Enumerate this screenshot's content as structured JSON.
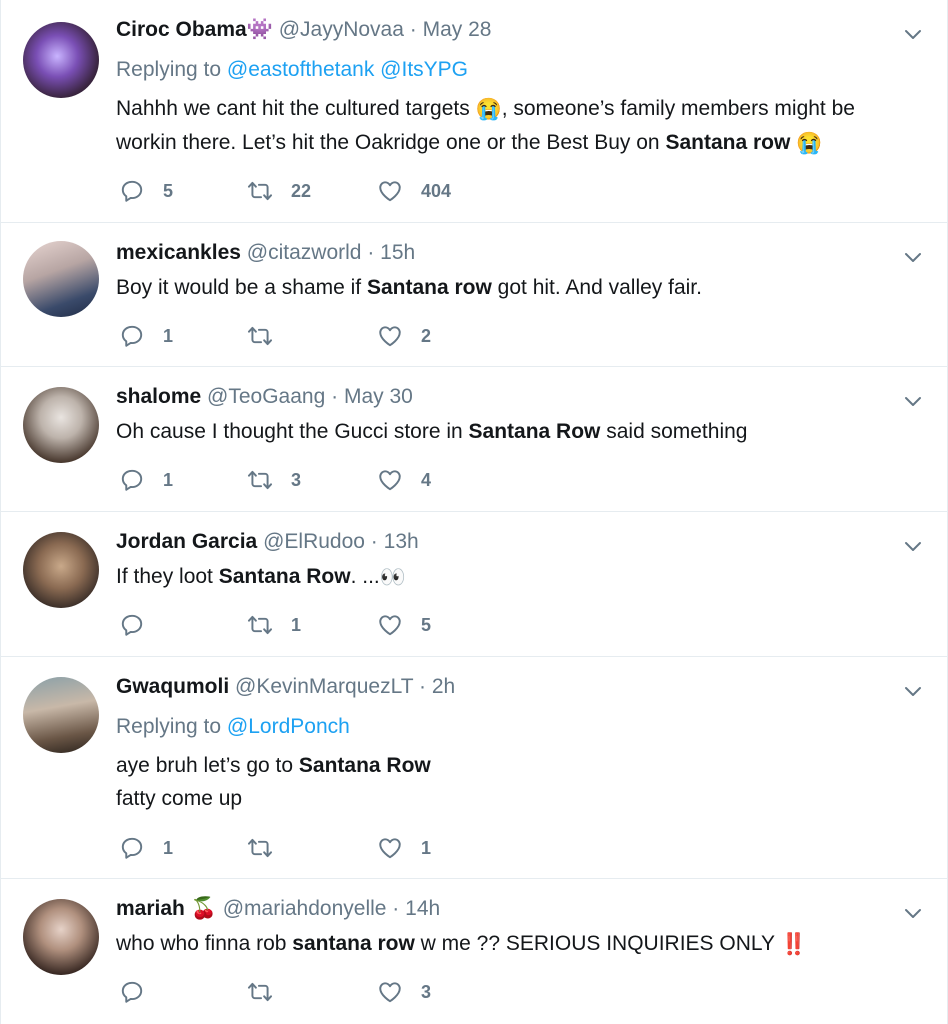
{
  "tweets": [
    {
      "name": "Ciroc Obama",
      "name_emoji": "👾",
      "handle": "@JayyNovaa",
      "time": "May 28",
      "replying_label": "Replying to",
      "replying_to": [
        "@eastofthetank",
        "@ItsYPG"
      ],
      "text_parts": [
        "Nahhh we cant hit the cultured targets ",
        "😭",
        ", someone’s family members might be workin there. Let’s hit the Oakridge one or the Best Buy on ",
        "Santana row",
        " ",
        "😭"
      ],
      "replies": "5",
      "retweets": "22",
      "likes": "404"
    },
    {
      "name": "mexicankles",
      "handle": "@citazworld",
      "time": "15h",
      "text_before": "Boy it would be a shame if ",
      "text_bold": "Santana row",
      "text_after": " got hit. And valley fair.",
      "replies": "1",
      "retweets": "",
      "likes": "2"
    },
    {
      "name": "shalome",
      "handle": "@TeoGaang",
      "time": "May 30",
      "text_before": "Oh cause I thought the Gucci store in ",
      "text_bold": "Santana Row",
      "text_after": " said something",
      "replies": "1",
      "retweets": "3",
      "likes": "4"
    },
    {
      "name": "Jordan Garcia",
      "handle": "@ElRudoo",
      "time": "13h",
      "text_before": "If they loot ",
      "text_bold": "Santana Row",
      "text_after": ". ...",
      "text_emoji": "👀",
      "replies": "",
      "retweets": "1",
      "likes": "5"
    },
    {
      "name": "Gwaqumoli",
      "handle": "@KevinMarquezLT",
      "time": "2h",
      "replying_label": "Replying to",
      "replying_to": [
        "@LordPonch"
      ],
      "text_before": "aye bruh let’s go to ",
      "text_bold": "Santana Row",
      "text_line2": "fatty come up",
      "replies": "1",
      "retweets": "",
      "likes": "1"
    },
    {
      "name": "mariah",
      "name_emoji": "🍒",
      "handle": "@mariahdonyelle",
      "time": "14h",
      "text_before": "who who finna rob ",
      "text_bold": "santana row",
      "text_after": " w me ?? SERIOUS INQUIRIES ONLY ",
      "text_emoji": "‼️",
      "replies": "",
      "retweets": "",
      "likes": "3"
    }
  ],
  "separator": "·",
  "colors": {
    "text": "#14171a",
    "secondary": "#657786",
    "link": "#1da1f2",
    "divider": "#e6ecf0"
  },
  "icons": [
    "reply-icon",
    "retweet-icon",
    "like-icon",
    "caret-down-icon"
  ]
}
